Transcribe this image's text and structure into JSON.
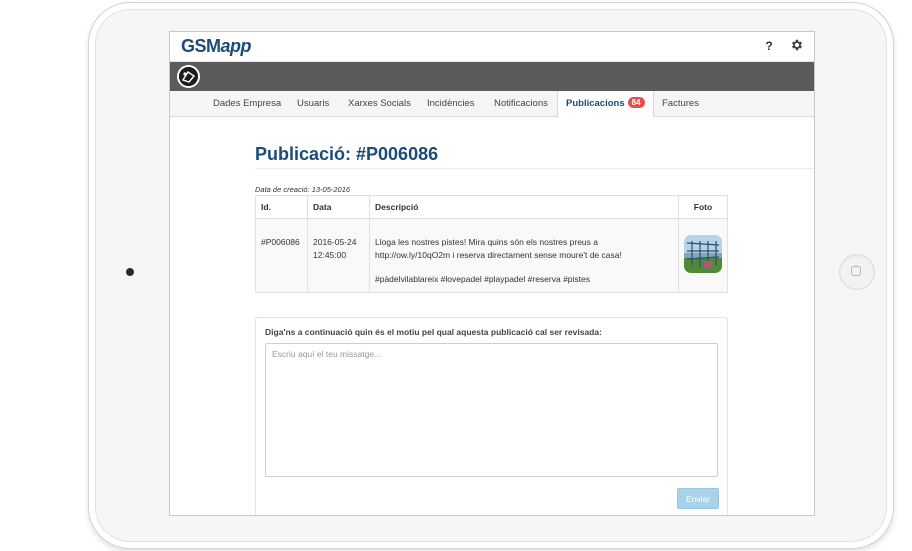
{
  "app": {
    "logo_prefix": "GSM",
    "logo_suffix": "app",
    "help_label": "?"
  },
  "tabs": [
    {
      "label": "Dades Empresa"
    },
    {
      "label": "Usuaris"
    },
    {
      "label": "Xarxes Socials"
    },
    {
      "label": "Incidències"
    },
    {
      "label": "Notificacions"
    },
    {
      "label": "Publicacions",
      "badge": "84",
      "active": true
    },
    {
      "label": "Factures"
    }
  ],
  "page": {
    "title": "Publicació: #P006086",
    "created": "Data de creació: 13-05-2016"
  },
  "table": {
    "headers": [
      "Id.",
      "Data",
      "Descripció",
      "Foto"
    ],
    "row": {
      "id": "#P006086",
      "date": "2016-05-24",
      "time": "12:45:00",
      "desc_line1": "Lloga les nostres pistes! Mira quins són els nostres preus a",
      "desc_line2": "http://ow.ly/10qO2m i reserva directament sense moure't de casa!",
      "hashtags": "#pàdelvilablareix #lovepadel #playpadel #reserva #pistes"
    }
  },
  "form": {
    "label": "Diga'ns a continuació quin és el motiu pel qual aquesta publicació cal ser revisada:",
    "placeholder": "Escriu aquí el teu missatge...",
    "value": "",
    "submit_label": "Enviar"
  },
  "colors": {
    "brand": "#1c4b78",
    "badge": "#e74c4c",
    "submit_disabled": "#a8d2ea",
    "darkbar": "#5b5b5b"
  },
  "icons": [
    "gear-icon",
    "avatar-logo",
    "post-photo-thumbnail"
  ]
}
